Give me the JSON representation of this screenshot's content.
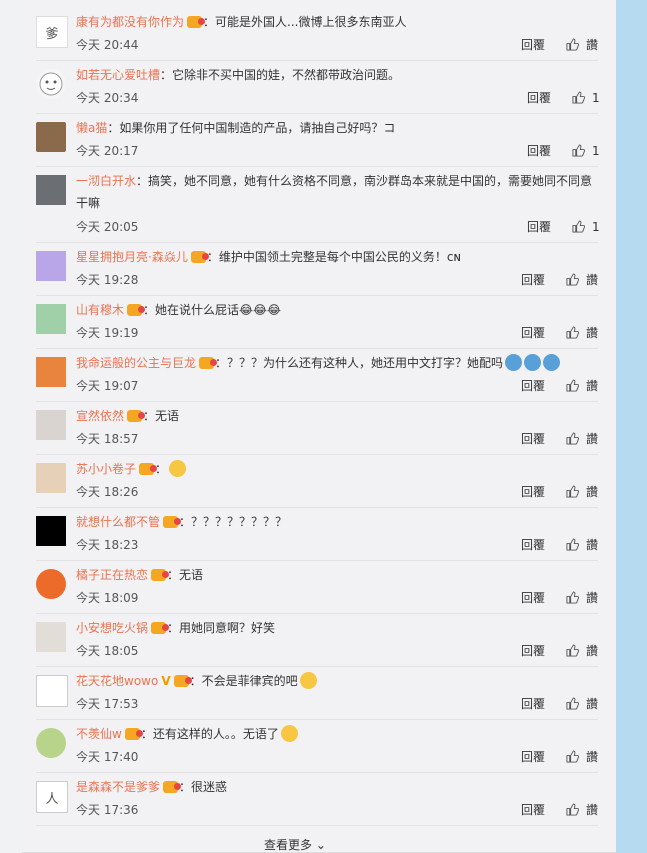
{
  "comments": [
    {
      "user": "康有为都没有你作为",
      "text": "：可能是外国人...微博上很多东南亚人",
      "time": "今天 20:44",
      "reply": "回覆",
      "like": "讚",
      "avatar_text": "爹"
    },
    {
      "user": "如若无心爱吐槽",
      "text": "：它除非不买中国的娃，不然都带政治问题。",
      "time": "今天 20:34",
      "reply": "回覆",
      "like": "1"
    },
    {
      "user": "懒a猫",
      "text": "：如果你用了任何中国制造的产品，请抽自己好吗？コ",
      "time": "今天 20:17",
      "reply": "回覆",
      "like": "1"
    },
    {
      "user": "一沏白开水",
      "text": "：搞笑，她不同意，她有什么资格不同意，南沙群岛本来就是中国的，需要她同不同意",
      "text2": "干嘛",
      "time": "今天 20:05",
      "reply": "回覆",
      "like": "1"
    },
    {
      "user": "星星拥抱月亮·森焱儿",
      "text": "：维护中国领土完整是每个中国公民的义务！ᴄɴ",
      "time": "今天 19:28",
      "reply": "回覆",
      "like": "讚"
    },
    {
      "user": "山有穆木",
      "text": "：她在说什么屁话😂😂😂",
      "time": "今天 19:19",
      "reply": "回覆",
      "like": "讚"
    },
    {
      "user": "我命运般的公主与巨龙",
      "text": "：？？？为什么还有这种人，她还用中文打字？她配吗",
      "time": "今天 19:07",
      "reply": "回覆",
      "like": "讚"
    },
    {
      "user": "宣然依然",
      "text": "：无语",
      "time": "今天 18:57",
      "reply": "回覆",
      "like": "讚"
    },
    {
      "user": "苏小小卷子",
      "text": "：",
      "time": "今天 18:26",
      "reply": "回覆",
      "like": "讚"
    },
    {
      "user": "就想什么都不管",
      "text": "：？？？？？？？？",
      "time": "今天 18:23",
      "reply": "回覆",
      "like": "讚"
    },
    {
      "user": "橘子正在热恋",
      "text": "：无语",
      "time": "今天 18:09",
      "reply": "回覆",
      "like": "讚"
    },
    {
      "user": "小安想吃火锅",
      "text": "：用她同意啊？好笑",
      "time": "今天 18:05",
      "reply": "回覆",
      "like": "讚"
    },
    {
      "user": "花天花地wowo",
      "vip": "V",
      "text": "：不会是菲律宾的吧",
      "time": "今天 17:53",
      "reply": "回覆",
      "like": "讚"
    },
    {
      "user": "不羡仙w",
      "text": "：还有这样的人。。无语了",
      "time": "今天 17:40",
      "reply": "回覆",
      "like": "讚"
    },
    {
      "user": "是森森不是爹爹",
      "text": "：很迷惑",
      "time": "今天 17:36",
      "reply": "回覆",
      "like": "讚",
      "avatar_text": "人"
    }
  ],
  "footer": {
    "more_label": "查看更多"
  },
  "colors": {
    "username": "#eb7350",
    "background": "#f2f2f5",
    "side": "#b6daf0"
  }
}
